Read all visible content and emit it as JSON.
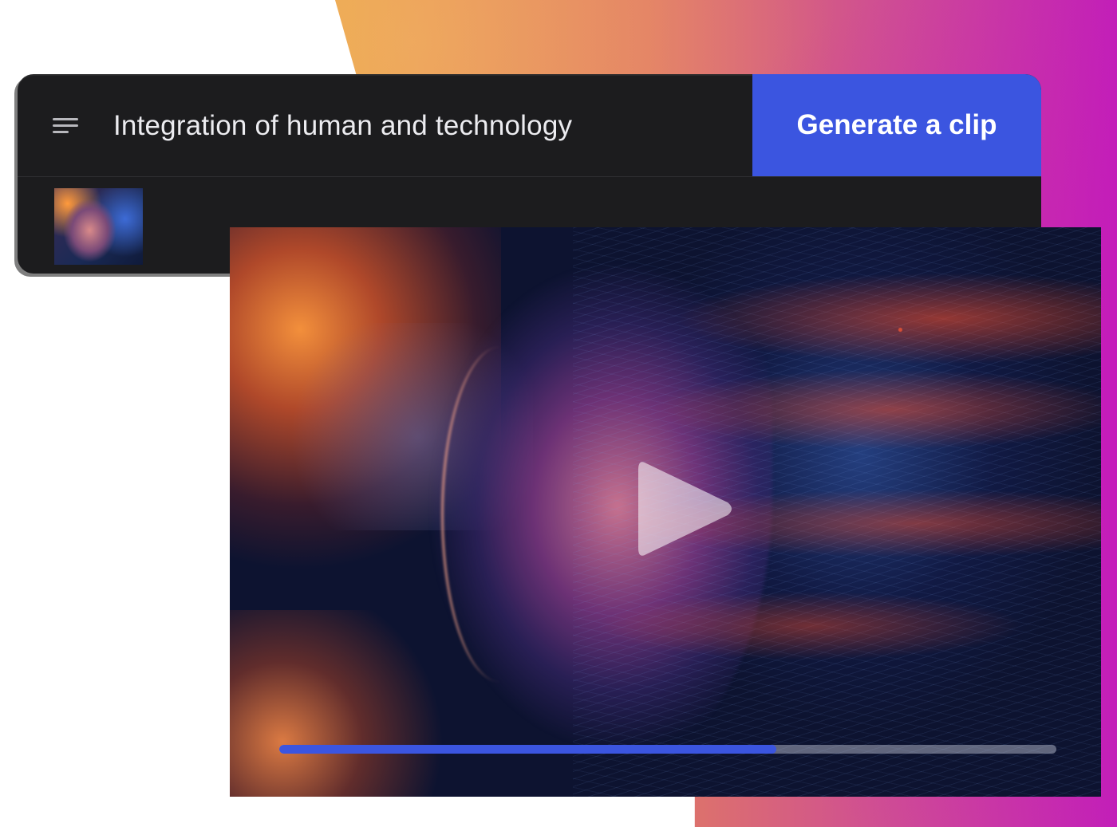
{
  "prompt": {
    "text": "Integration of human and technology",
    "menu_icon": "menu-lines-icon",
    "generate_label": "Generate a clip"
  },
  "thumbnail": {
    "icon": "clip-thumbnail"
  },
  "player": {
    "play_icon": "play-icon",
    "progress": 0.64
  },
  "colors": {
    "accent": "#3b55e0",
    "card_bg": "#1c1c1e",
    "gradient_start": "#e8a24a",
    "gradient_end": "#c21fb8"
  }
}
